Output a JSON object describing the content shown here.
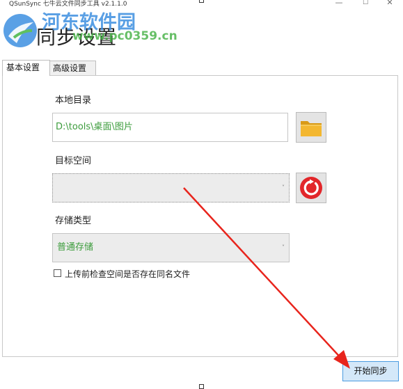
{
  "window": {
    "title": "QSunSync 七牛云文件同步工具 v2.1.1.0",
    "minimize_glyph": "—",
    "maximize_glyph": "☐",
    "close_glyph": "✕"
  },
  "header": {
    "title": "同步设置",
    "watermark_name": "河东软件园",
    "watermark_url": "www.pc0359.cn"
  },
  "tabs": [
    {
      "label": "基本设置",
      "active": true
    },
    {
      "label": "高级设置",
      "active": false
    }
  ],
  "form": {
    "local_dir_label": "本地目录",
    "local_dir_value": "D:\\tools\\桌面\\图片",
    "target_space_label": "目标空间",
    "target_space_value": "",
    "storage_type_label": "存储类型",
    "storage_type_value": "普通存储",
    "check_label": "上传前检查空间是否存在同名文件",
    "check_checked": false,
    "chevron_glyph": "˅"
  },
  "icons": {
    "folder": "folder-icon",
    "refresh": "refresh-icon",
    "logo": "app-logo-icon"
  },
  "actions": {
    "start_sync_label": "开始同步"
  },
  "colors": {
    "value_text": "#3c9c3c",
    "refresh_red": "#e2262a",
    "folder_yellow": "#f0b328",
    "annotation_arrow": "#e8241c",
    "start_button_border": "#4a9be0"
  }
}
